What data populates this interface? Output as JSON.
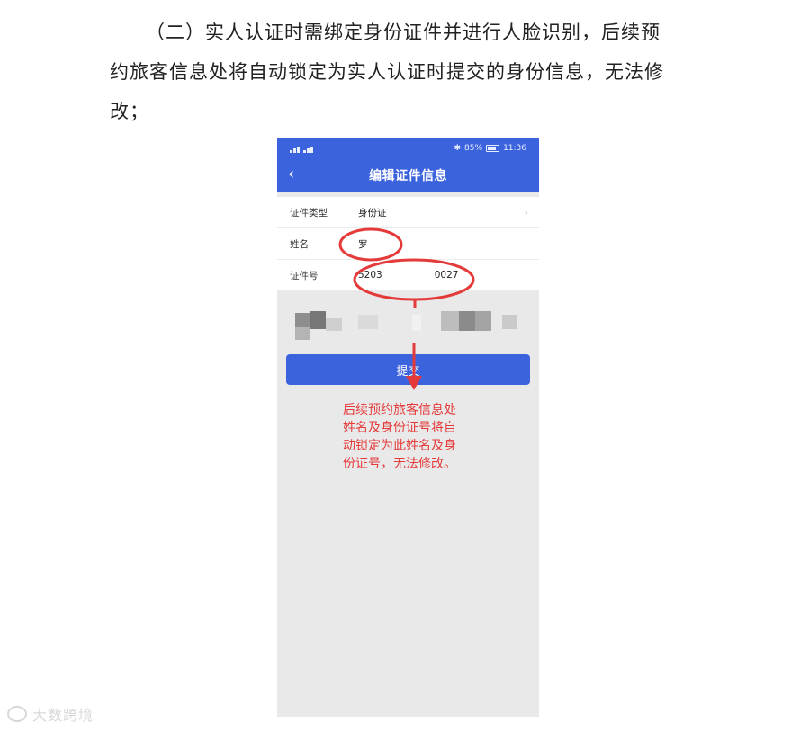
{
  "paragraph": {
    "line1": "（二）实人认证时需绑定身份证件并进行人脸识别，后续预",
    "line2": "约旅客信息处将自动锁定为实人认证时提交的身份信息，无法修",
    "line3": "改；"
  },
  "phone": {
    "status": {
      "battery": "85%",
      "time": "11:36"
    },
    "nav": {
      "back_icon": "chevron-left-icon",
      "title": "编辑证件信息"
    },
    "form": {
      "rows": [
        {
          "label": "证件类型",
          "value": "身份证"
        },
        {
          "label": "姓名",
          "value": "罗"
        },
        {
          "label": "证件号",
          "value_start": "5203",
          "value_end": "0027"
        }
      ]
    },
    "submit_label": "提交"
  },
  "annotation": {
    "line1": "后续预约旅客信息处",
    "line2": "姓名及身份证号将自",
    "line3": "动锁定为此姓名及身",
    "line4": "份证号，无法修改。"
  },
  "colors": {
    "accent": "#3b63dd",
    "annotation": "#e53a3a"
  },
  "watermark": "大数跨境"
}
